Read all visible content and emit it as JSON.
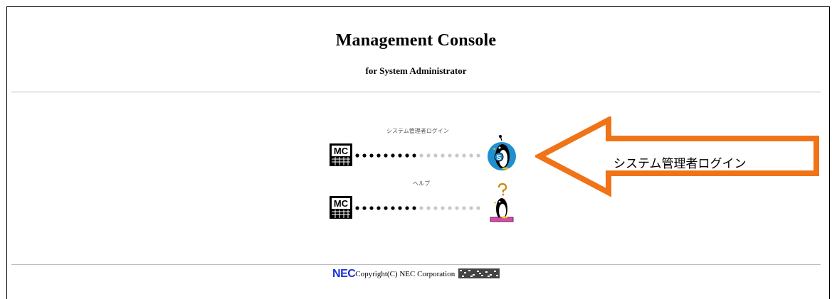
{
  "header": {
    "title": "Management Console",
    "subtitle": "for System Administrator"
  },
  "menu": {
    "items": [
      {
        "label": "システム管理者ログイン",
        "icon": "penguin-s-icon",
        "logo": "mc-logo-icon"
      },
      {
        "label": "ヘルプ",
        "icon": "penguin-question-icon",
        "logo": "mc-logo-icon"
      }
    ]
  },
  "callout": {
    "label": "システム管理者ログイン",
    "color": "#f07417"
  },
  "footer": {
    "brand": "NEC",
    "copyright": "Copyright(C) NEC Corporation",
    "brand_color": "#1c2fd8"
  }
}
